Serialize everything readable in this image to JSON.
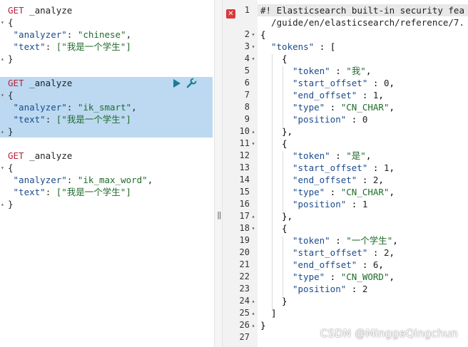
{
  "requests": [
    {
      "method": "GET",
      "endpoint": "_analyze",
      "analyzer_key": "\"analyzer\"",
      "analyzer_value": "\"chinese\"",
      "text_key": "\"text\"",
      "text_value": "[\"我是一个学生\"]",
      "selected": false
    },
    {
      "method": "GET",
      "endpoint": "_analyze",
      "analyzer_key": "\"analyzer\"",
      "analyzer_value": "\"ik_smart\"",
      "text_key": "\"text\"",
      "text_value": "[\"我是一个学生\"]",
      "selected": true
    },
    {
      "method": "GET",
      "endpoint": "_analyze",
      "analyzer_key": "\"analyzer\"",
      "analyzer_value": "\"ik_max_word\"",
      "text_key": "\"text\"",
      "text_value": "[\"我是一个学生\"]",
      "selected": false
    }
  ],
  "response": {
    "line_numbers": [
      "1",
      "2",
      "3",
      "4",
      "5",
      "6",
      "7",
      "8",
      "9",
      "10",
      "11",
      "12",
      "13",
      "14",
      "15",
      "16",
      "17",
      "18",
      "19",
      "20",
      "21",
      "22",
      "23",
      "24",
      "25",
      "26",
      "27"
    ],
    "comment_line1": "#! Elasticsearch built-in security fea",
    "comment_line2": "/guide/en/elasticsearch/reference/7.",
    "tokens_key": "\"tokens\"",
    "tokens": [
      {
        "token": "\"我\"",
        "start_offset": "0",
        "end_offset": "1",
        "type": "\"CN_CHAR\"",
        "position": "0"
      },
      {
        "token": "\"是\"",
        "start_offset": "1",
        "end_offset": "2",
        "type": "\"CN_CHAR\"",
        "position": "1"
      },
      {
        "token": "\"一个学生\"",
        "start_offset": "2",
        "end_offset": "6",
        "type": "\"CN_WORD\"",
        "position": "2"
      }
    ],
    "field_keys": {
      "token": "\"token\"",
      "start_offset": "\"start_offset\"",
      "end_offset": "\"end_offset\"",
      "type": "\"type\"",
      "position": "\"position\""
    },
    "error_icon": "close-icon"
  },
  "watermark": "CSDN @MinggeQingchun",
  "colors": {
    "selection": "#bcd9f1",
    "method": "#b4253e",
    "key": "#1a4b8c",
    "string": "#1f6b2a",
    "play": "#197d8f",
    "error": "#d9393b"
  }
}
